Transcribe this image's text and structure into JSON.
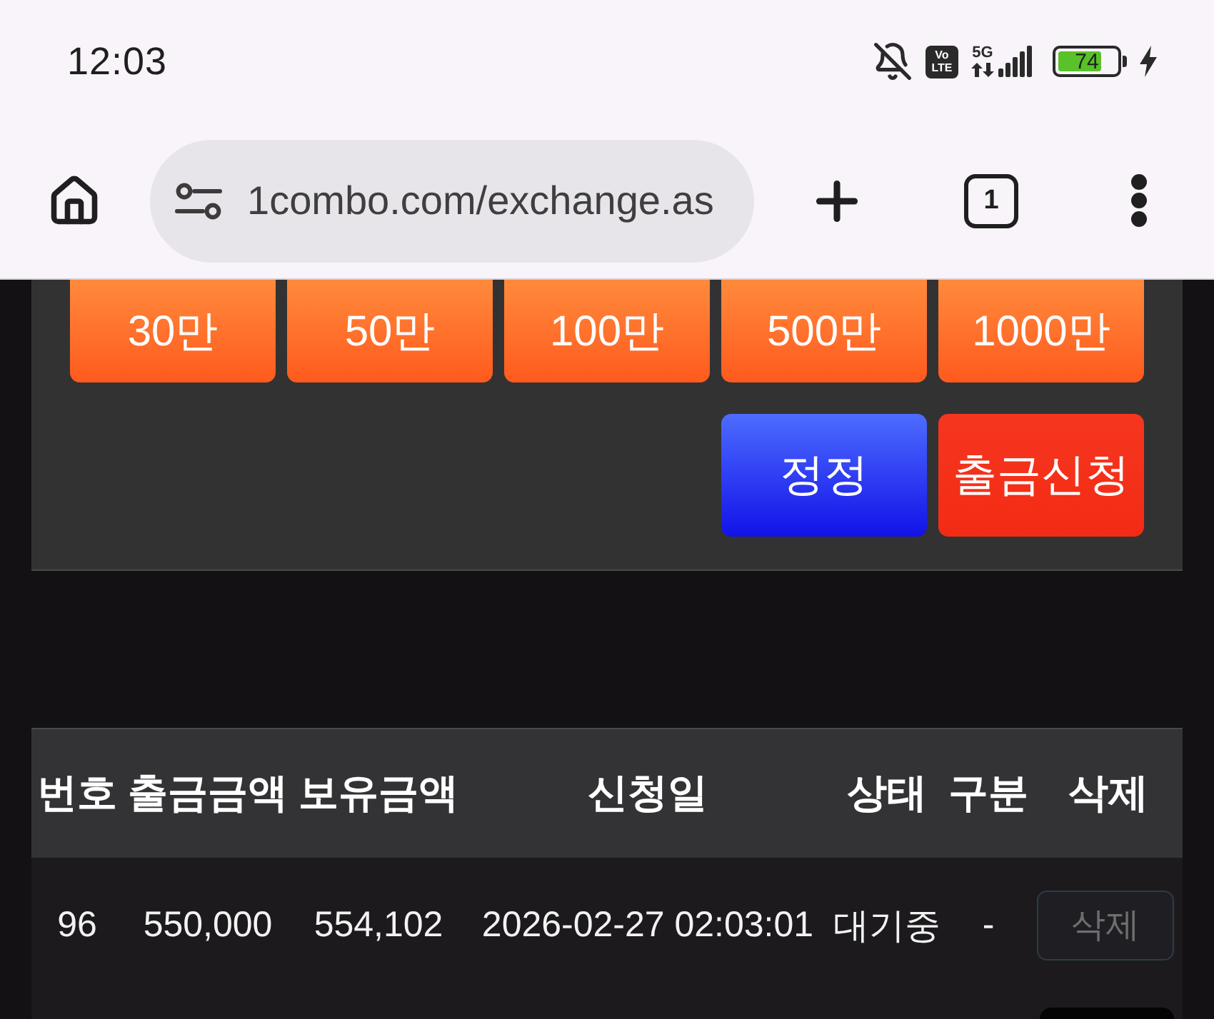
{
  "status_bar": {
    "time": "12:03",
    "volte": [
      "Vo",
      "LTE"
    ],
    "network": "5G",
    "battery": {
      "text": "74",
      "level": 0.74,
      "charging": true
    }
  },
  "browser": {
    "url": "1combo.com/exchange.as",
    "tab_count": "1"
  },
  "amount_buttons": [
    "30만",
    "50만",
    "100만",
    "500만",
    "1000만"
  ],
  "actions": [
    {
      "label": "정정",
      "kind": "edit"
    },
    {
      "label": "출금신청",
      "kind": "submit"
    }
  ],
  "table": {
    "columns": [
      "번호",
      "출금금액",
      "보유금액",
      "신청일",
      "상태",
      "구분",
      "삭제"
    ],
    "rows": [
      {
        "cells": [
          "96",
          "550,000",
          "554,102",
          "2026-02-27 02:03:01",
          "대기중",
          "-"
        ],
        "delete": {
          "label": "삭제",
          "disabled": true
        }
      }
    ]
  }
}
